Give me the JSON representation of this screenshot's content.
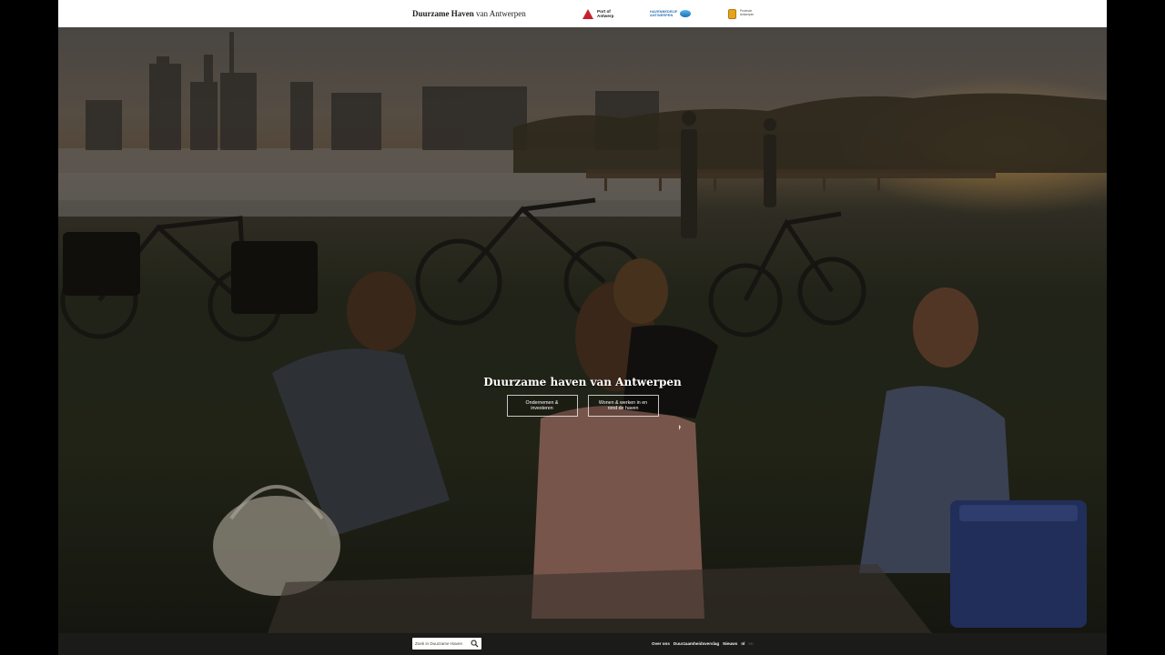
{
  "header": {
    "site_title_bold": "Duurzame Haven",
    "site_title_rest": "van Antwerpen",
    "partners": {
      "port_line1": "Port of",
      "port_line2": "Antwerp",
      "rh_line1": "HAVENBEDRIJF",
      "rh_line2": "ANTWERPEN",
      "prov_line1": "Provincie",
      "prov_line2": "Antwerpen"
    }
  },
  "hero": {
    "title": "Duurzame haven van Antwerpen",
    "buttons": [
      {
        "label": "Ondernemen & investeren"
      },
      {
        "label": "Wonen & werken in en rond de haven"
      }
    ]
  },
  "footer": {
    "search_placeholder": "Zoek in Duurzame Haven",
    "nav": [
      {
        "label": "Over ons"
      },
      {
        "label": "Duurzaamheidsverslag"
      },
      {
        "label": "Nieuws"
      },
      {
        "label": "nl"
      },
      {
        "label": "en"
      }
    ]
  },
  "colors": {
    "port_red": "#c8202f",
    "header_bg": "#ffffff",
    "footer_bg": "#1b1b19"
  }
}
